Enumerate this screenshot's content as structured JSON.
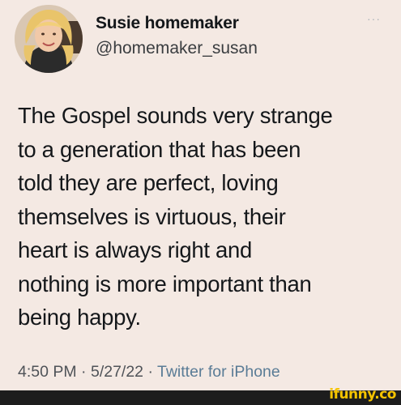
{
  "user": {
    "display_name": "Susie homemaker",
    "handle": "@homemaker_susan",
    "avatar_icon": "profile-photo"
  },
  "tweet": {
    "text": "The Gospel sounds very strange\nto a generation that has been\ntold they are perfect, loving\nthemselves is virtuous, their\nheart is always right and\nnothing is more important than\nbeing happy.",
    "time": "4:50 PM",
    "date": "5/27/22",
    "separator": " · ",
    "source": "Twitter for iPhone"
  },
  "menu": {
    "more_label": "···"
  },
  "watermark": {
    "text": "ifunny.co",
    "color": "#f5c400"
  }
}
